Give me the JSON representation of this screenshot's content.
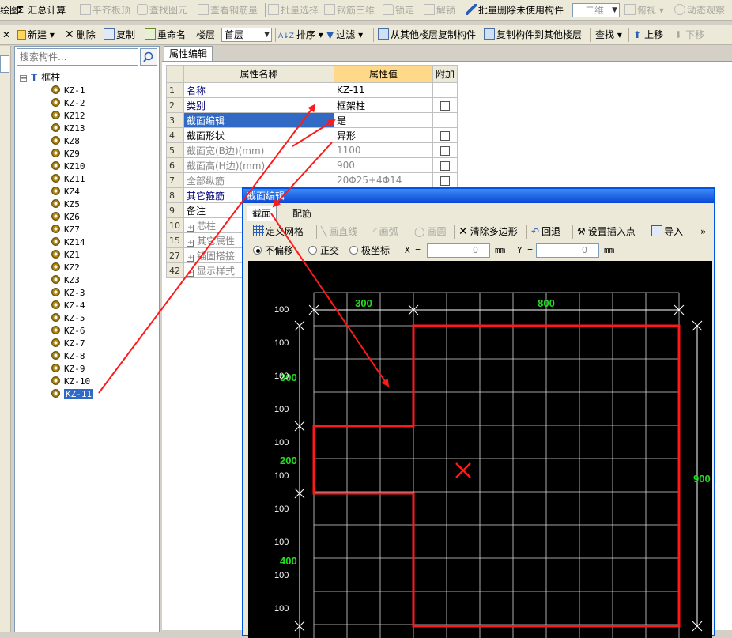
{
  "toolbar1": {
    "items": [
      "绘图",
      "汇总计算",
      "平齐板顶",
      "查找图元",
      "查看钢筋量",
      "批量选择",
      "钢筋三维",
      "锁定",
      "解锁",
      "批量删除未使用构件",
      "二维",
      "俯视",
      "动态观察"
    ]
  },
  "toolbar2": {
    "new": "新建",
    "delete": "删除",
    "copy": "复制",
    "rename": "重命名",
    "floor_label": "楼层",
    "floor_value": "首层",
    "sort": "排序",
    "filter": "过滤",
    "copy_from_other": "从其他楼层复制构件",
    "copy_to_other": "复制构件到其他楼层",
    "find": "查找",
    "move_up": "上移",
    "move_down": "下移"
  },
  "tree": {
    "search_placeholder": "搜索构件...",
    "root": "框柱",
    "items": [
      "KZ-1",
      "KZ-2",
      "KZ12",
      "KZ13",
      "KZ8",
      "KZ9",
      "KZ10",
      "KZ11",
      "KZ4",
      "KZ5",
      "KZ6",
      "KZ7",
      "KZ14",
      "KZ1",
      "KZ2",
      "KZ3",
      "KZ-3",
      "KZ-4",
      "KZ-5",
      "KZ-6",
      "KZ-7",
      "KZ-8",
      "KZ-9",
      "KZ-10",
      "KZ-11"
    ],
    "selected": "KZ-11"
  },
  "props": {
    "tab": "属性编辑",
    "headers": [
      "属性名称",
      "属性值",
      "附加"
    ],
    "rows": [
      {
        "num": "1",
        "name": "名称",
        "value": "KZ-11",
        "check": false
      },
      {
        "num": "2",
        "name": "类别",
        "value": "框架柱",
        "check": true
      },
      {
        "num": "3",
        "name": "截面编辑",
        "value": "是",
        "check": false
      },
      {
        "num": "4",
        "name": "截面形状",
        "value": "异形",
        "check": true
      },
      {
        "num": "5",
        "name": "截面宽(B边)(mm)",
        "value": "1100",
        "check": true
      },
      {
        "num": "6",
        "name": "截面高(H边)(mm)",
        "value": "900",
        "check": true
      },
      {
        "num": "7",
        "name": "全部纵筋",
        "value": "20Φ25+4Φ14",
        "check": true
      },
      {
        "num": "8",
        "name": "其它箍筋",
        "value": "",
        "check": false
      },
      {
        "num": "9",
        "name": "备注",
        "value": "",
        "check": false
      },
      {
        "num": "10",
        "name": "芯柱",
        "value": "",
        "check": false
      },
      {
        "num": "15",
        "name": "其它属性",
        "value": "",
        "check": false
      },
      {
        "num": "27",
        "name": "锚固搭接",
        "value": "",
        "check": false
      },
      {
        "num": "42",
        "name": "显示样式",
        "value": "",
        "check": false
      }
    ]
  },
  "dialog": {
    "title": "截面编辑",
    "tabs": [
      "截面",
      "配筋"
    ],
    "tools": [
      "定义网格",
      "画直线",
      "画弧",
      "画圆",
      "清除多边形",
      "回退",
      "设置插入点",
      "导入"
    ],
    "modes": [
      "不偏移",
      "正交",
      "极坐标"
    ],
    "x_label": "X =",
    "x_value": "0",
    "y_label": "Y =",
    "y_value": "0",
    "unit": "mm",
    "dims": {
      "top": [
        "300",
        "800"
      ],
      "left_groups": [
        "300",
        "200",
        "400"
      ],
      "right": "900",
      "grid": [
        "100",
        "100",
        "100",
        "100",
        "100",
        "100",
        "100",
        "100",
        "100",
        "100"
      ]
    }
  },
  "colors": {
    "accent": "#316ac5",
    "shape": "#ff1a1a",
    "dim": "#22dd22",
    "grid": "#d8d8d8"
  }
}
